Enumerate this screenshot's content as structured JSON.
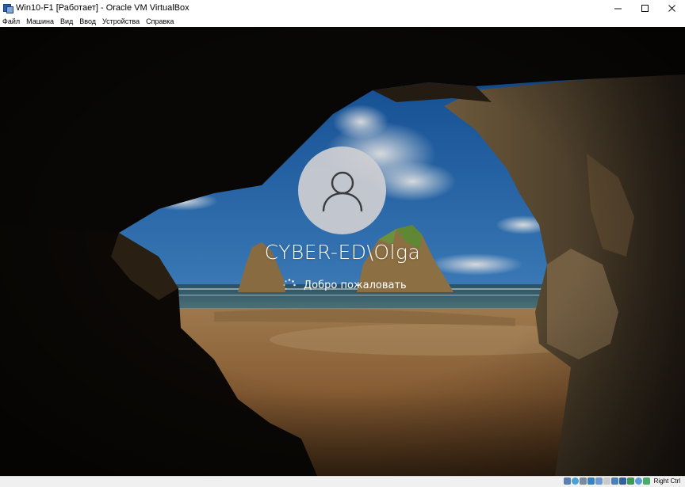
{
  "window": {
    "title": "Win10-F1 [Работает] - Oracle VM VirtualBox",
    "controls": {
      "minimize": "–",
      "maximize": "☐",
      "close": "✕"
    }
  },
  "menu": {
    "items": [
      {
        "label": "Файл"
      },
      {
        "label": "Машина"
      },
      {
        "label": "Вид"
      },
      {
        "label": "Ввод"
      },
      {
        "label": "Устройства"
      },
      {
        "label": "Справка"
      }
    ]
  },
  "guest": {
    "screen": "windows-10-sign-in",
    "username": "CYBER-ED\\Olga",
    "status_text": "Добро пожаловать",
    "avatar_icon": "user-icon",
    "busy_icon": "spinner-icon"
  },
  "statusbar": {
    "icons": [
      "hard-disk-icon",
      "optical-drive-icon",
      "audio-icon",
      "network-icon",
      "usb-icon",
      "shared-folders-icon",
      "display-icon",
      "video-capture-icon",
      "virtualization-icon",
      "mouse-integration-icon",
      "keyboard-icon"
    ],
    "host_key": "Right Ctrl"
  },
  "colors": {
    "sky_top": "#1a5fb0",
    "sky_bottom": "#8ec0e6",
    "sand": "#b07a45",
    "rock": "#6e5a3c",
    "statusbar": "#f0f0f0"
  }
}
